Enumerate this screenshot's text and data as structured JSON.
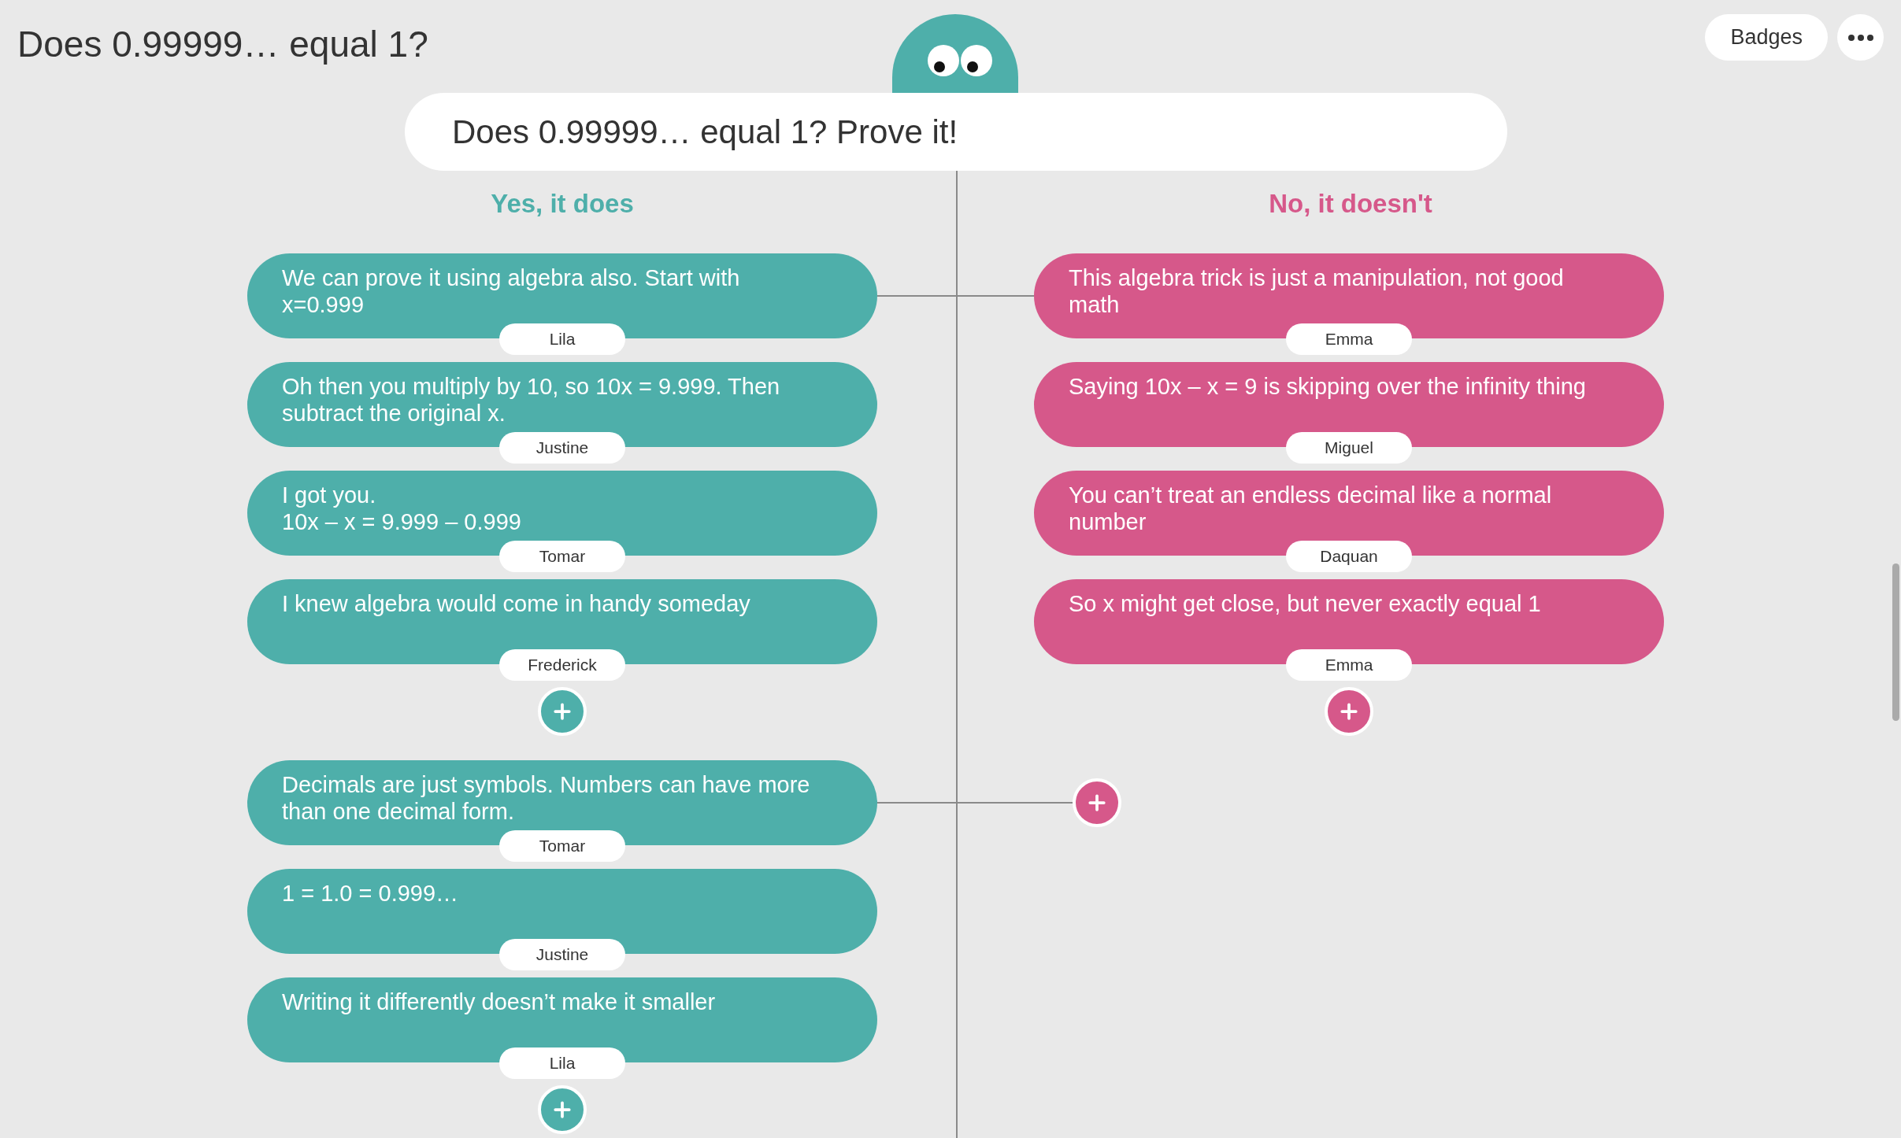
{
  "title": "Does 0.99999… equal 1?",
  "badges_button": "Badges",
  "prompt": "Does 0.99999… equal 1? Prove it!",
  "sides": [
    {
      "heading": "Yes, it does",
      "color": "#4eafaa"
    },
    {
      "heading": "No, it doesn't",
      "color": "#d6588a"
    }
  ],
  "threads": [
    {
      "yes": [
        {
          "text": "We can prove it using algebra also. Start with x=0.999",
          "author": "Lila"
        },
        {
          "text": "Oh then you multiply by 10, so 10x = 9.999. Then subtract the original x.",
          "author": "Justine"
        },
        {
          "text": "I got you.\n10x – x = 9.999 – 0.999",
          "author": "Tomar"
        },
        {
          "text": "I knew algebra would come in handy someday",
          "author": "Frederick"
        }
      ],
      "no": [
        {
          "text": "This algebra trick is just a manipulation, not good math",
          "author": "Emma"
        },
        {
          "text": "Saying 10x – x = 9 is skipping over the infinity thing",
          "author": "Miguel"
        },
        {
          "text": "You can’t treat an endless decimal like a normal number",
          "author": "Daquan"
        },
        {
          "text": "So x might get close, but never exactly equal 1",
          "author": "Emma"
        }
      ]
    },
    {
      "yes": [
        {
          "text": "Decimals are just symbols. Numbers can have more than one decimal form.",
          "author": "Tomar"
        },
        {
          "text": "1 = 1.0 = 0.999…",
          "author": "Justine"
        },
        {
          "text": "Writing it differently doesn’t make it smaller",
          "author": "Lila"
        }
      ]
    }
  ]
}
